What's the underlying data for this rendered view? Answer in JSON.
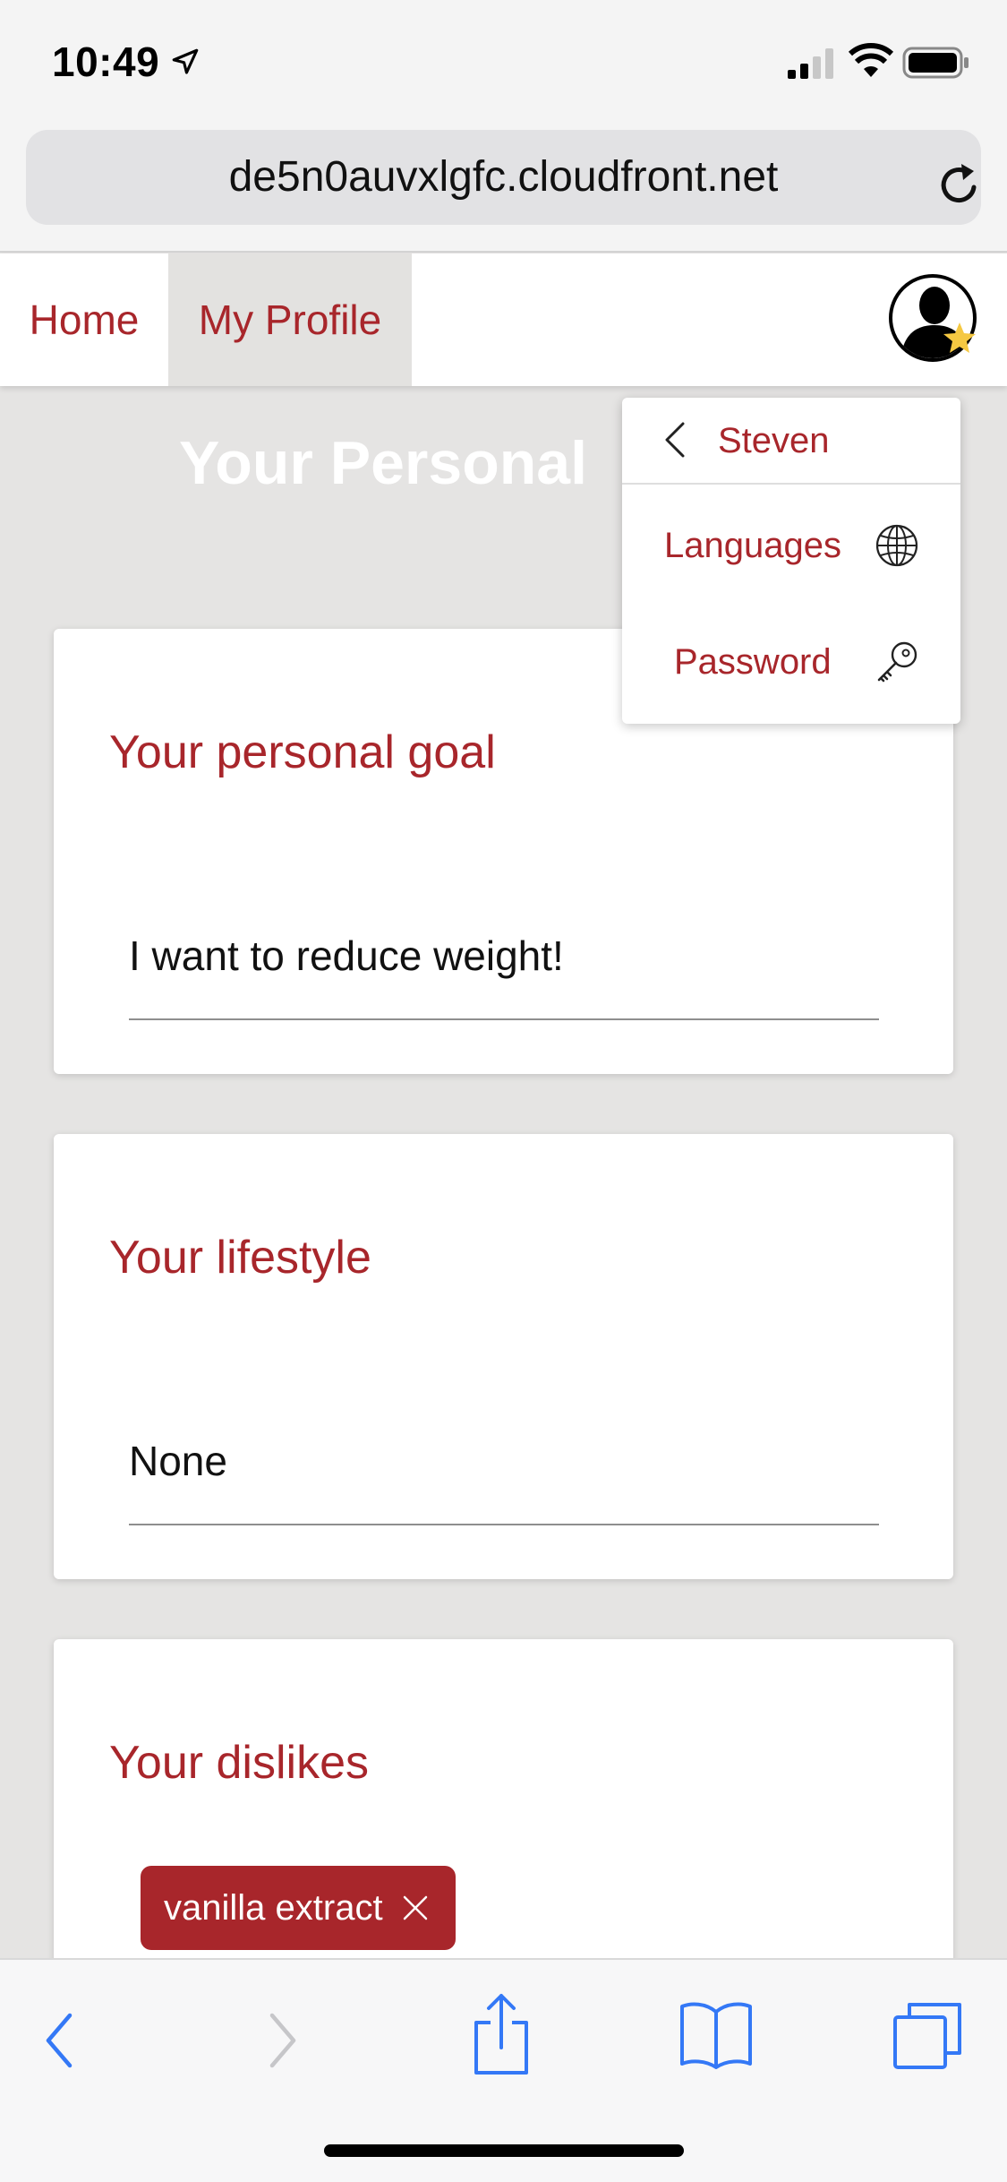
{
  "status_bar": {
    "time": "10:49"
  },
  "browser": {
    "url": "de5n0auvxlgfc.cloudfront.net"
  },
  "nav": {
    "home": "Home",
    "my_profile": "My Profile"
  },
  "page": {
    "title": "Your Personal"
  },
  "cards": {
    "goal": {
      "title": "Your personal goal",
      "value": "I want to reduce weight!"
    },
    "lifestyle": {
      "title": "Your lifestyle",
      "value": "None"
    },
    "dislikes": {
      "title": "Your dislikes",
      "chips": [
        "vanilla extract"
      ]
    }
  },
  "dropdown": {
    "user": "Steven",
    "languages": "Languages",
    "password": "Password"
  },
  "colors": {
    "accent": "#a8262b",
    "background": "#e5e4e3",
    "ios_blue": "#3478f6",
    "star": "#f5c842"
  },
  "icons": [
    "location-arrow-icon",
    "signal-icon",
    "wifi-icon",
    "battery-icon",
    "reload-icon",
    "avatar-icon",
    "star-icon",
    "chevron-left-icon",
    "globe-icon",
    "key-icon",
    "close-icon",
    "back-icon",
    "forward-icon",
    "share-icon",
    "bookmarks-icon",
    "tabs-icon"
  ]
}
